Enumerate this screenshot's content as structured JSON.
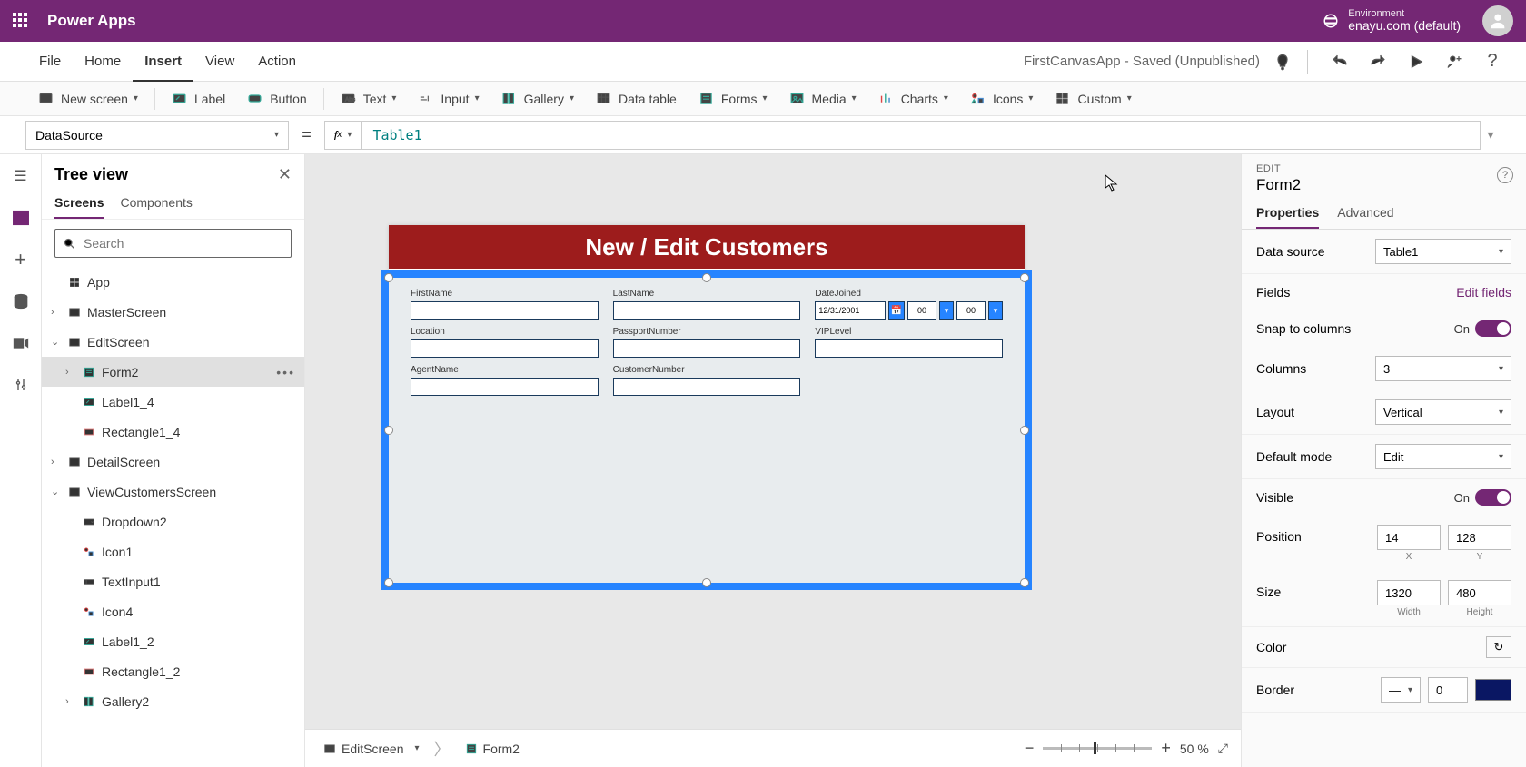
{
  "brand": "Power Apps",
  "environment": {
    "label": "Environment",
    "value": "enayu.com (default)"
  },
  "menu": {
    "file": "File",
    "home": "Home",
    "insert": "Insert",
    "view": "View",
    "action": "Action"
  },
  "appStatus": "FirstCanvasApp - Saved (Unpublished)",
  "ribbon": {
    "newScreen": "New screen",
    "label": "Label",
    "button": "Button",
    "text": "Text",
    "input": "Input",
    "gallery": "Gallery",
    "dataTable": "Data table",
    "forms": "Forms",
    "media": "Media",
    "charts": "Charts",
    "icons": "Icons",
    "custom": "Custom"
  },
  "formula": {
    "property": "DataSource",
    "value": "Table1"
  },
  "treeview": {
    "title": "Tree view",
    "tabs": {
      "screens": "Screens",
      "components": "Components"
    },
    "searchPlaceholder": "Search",
    "nodes": {
      "app": "App",
      "master": "MasterScreen",
      "edit": "EditScreen",
      "form2": "Form2",
      "label1_4": "Label1_4",
      "rect1_4": "Rectangle1_4",
      "detail": "DetailScreen",
      "viewcust": "ViewCustomersScreen",
      "dropdown2": "Dropdown2",
      "icon1": "Icon1",
      "textinput1": "TextInput1",
      "icon4": "Icon4",
      "label1_2": "Label1_2",
      "rect1_2": "Rectangle1_2",
      "gallery2": "Gallery2"
    }
  },
  "canvas": {
    "headerText": "New / Edit Customers",
    "fields": {
      "firstName": "FirstName",
      "lastName": "LastName",
      "dateJoined": "DateJoined",
      "dateValue": "12/31/2001",
      "hour": "00",
      "minute": "00",
      "location": "Location",
      "passport": "PassportNumber",
      "vip": "VIPLevel",
      "agent": "AgentName",
      "custnum": "CustomerNumber"
    },
    "breadcrumb": {
      "screen": "EditScreen",
      "control": "Form2"
    },
    "zoom": "50  %"
  },
  "props": {
    "caption": "EDIT",
    "title": "Form2",
    "tabs": {
      "properties": "Properties",
      "advanced": "Advanced"
    },
    "dataSource": {
      "label": "Data source",
      "value": "Table1"
    },
    "fields": {
      "label": "Fields",
      "link": "Edit fields"
    },
    "snap": {
      "label": "Snap to columns",
      "state": "On"
    },
    "columns": {
      "label": "Columns",
      "value": "3"
    },
    "layout": {
      "label": "Layout",
      "value": "Vertical"
    },
    "defaultMode": {
      "label": "Default mode",
      "value": "Edit"
    },
    "visible": {
      "label": "Visible",
      "state": "On"
    },
    "position": {
      "label": "Position",
      "x": "14",
      "y": "128",
      "xl": "X",
      "yl": "Y"
    },
    "size": {
      "label": "Size",
      "w": "1320",
      "h": "480",
      "wl": "Width",
      "hl": "Height"
    },
    "color": "Color",
    "border": {
      "label": "Border",
      "width": "0"
    }
  }
}
